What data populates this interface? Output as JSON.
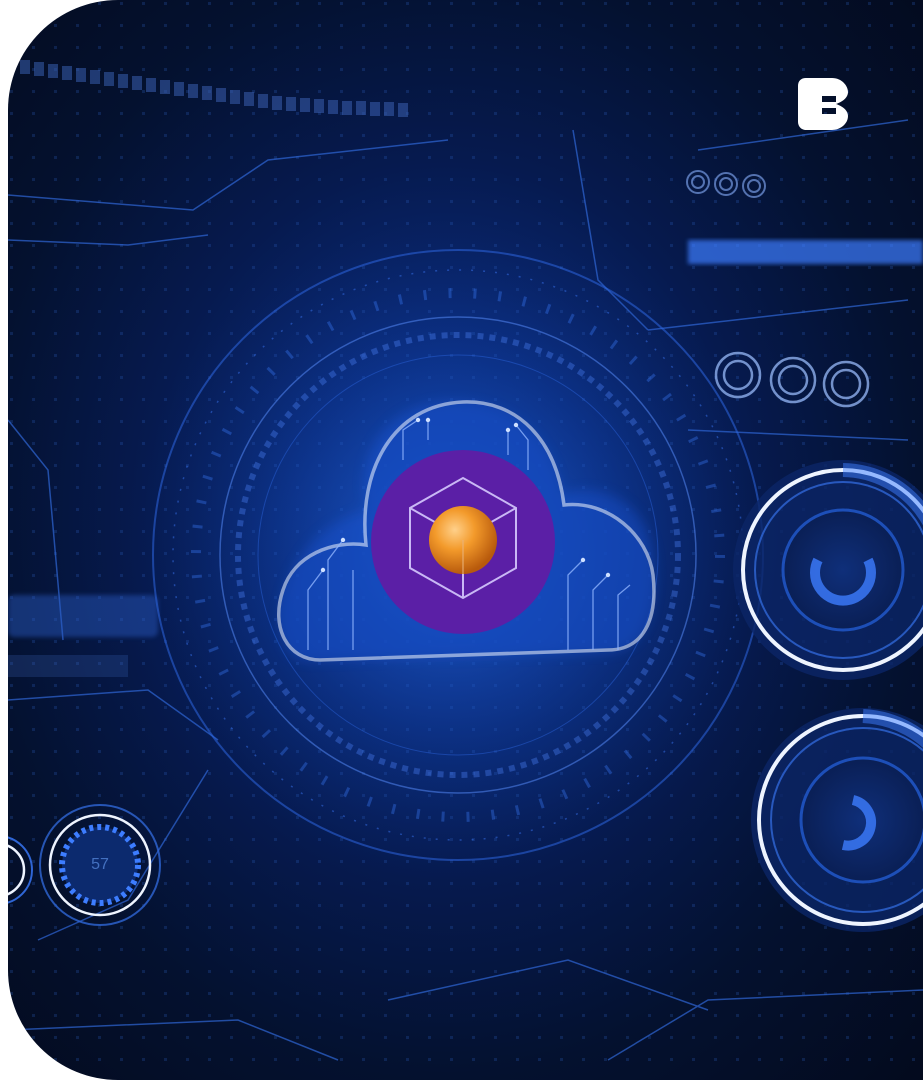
{
  "artwork": {
    "gauge_readout": "57",
    "brand_logo_icon": "brand-logo-icon",
    "central_icon": "cloud-cube-icon",
    "colors": {
      "background_dark": "#030a1d",
      "glow_blue": "#1f6cff",
      "line_blue": "#3d7dff",
      "cloud_outline": "#e9f1ff",
      "purple_badge": "#5b1fa6",
      "orange_core": "#f39a2b"
    }
  }
}
